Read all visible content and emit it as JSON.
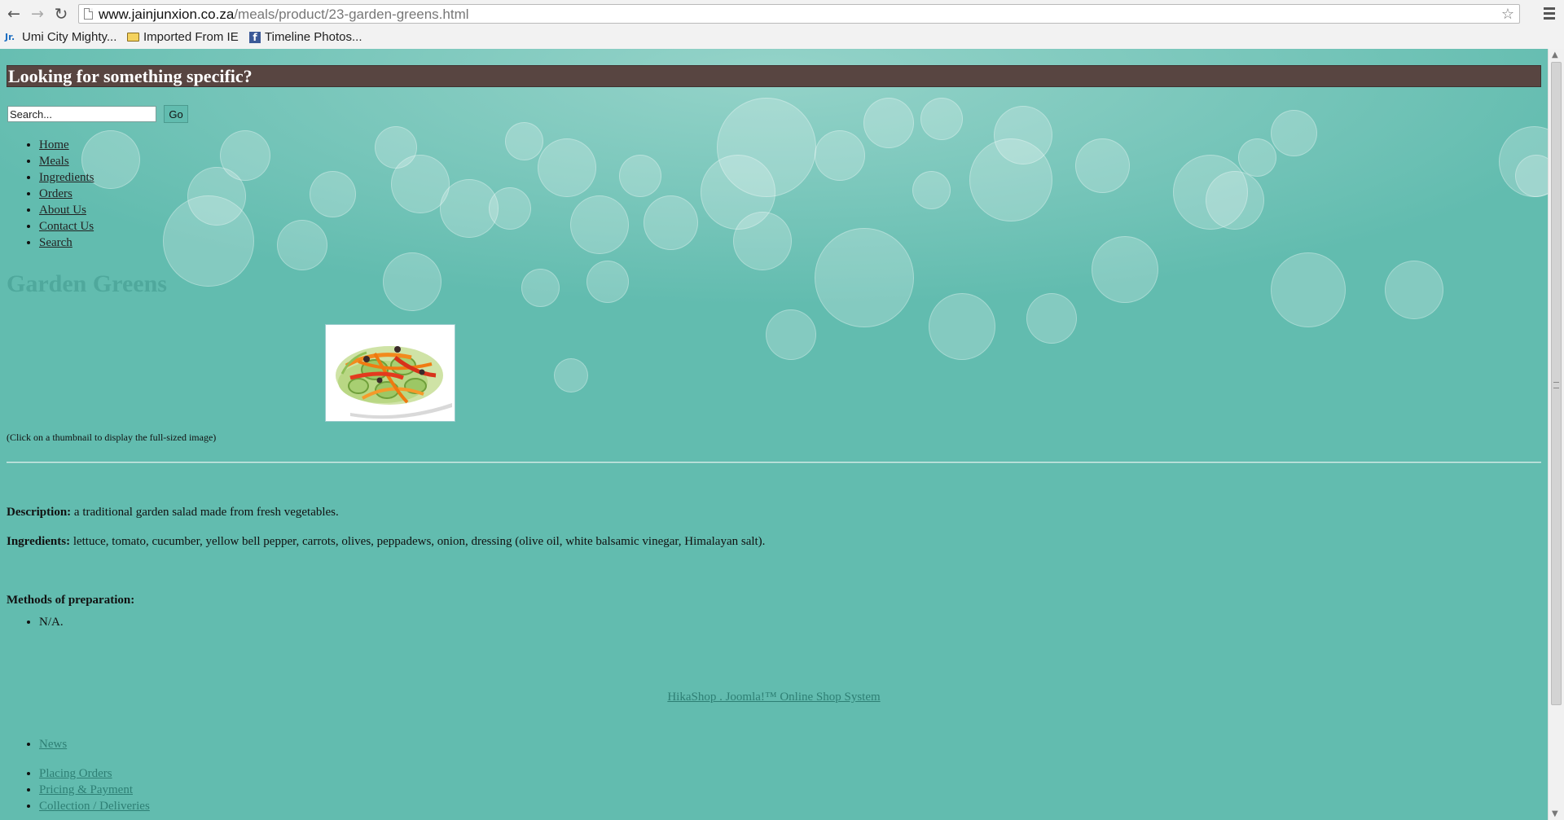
{
  "browser": {
    "url_host": "www.jainjunxion.co.za",
    "url_path": "/meals/product/23-garden-greens.html",
    "bookmarks": [
      {
        "label": "Umi City Mighty...",
        "icon": "jr-favicon-icon"
      },
      {
        "label": "Imported From IE",
        "icon": "folder-icon"
      },
      {
        "label": "Timeline Photos...",
        "icon": "facebook-icon"
      }
    ]
  },
  "page": {
    "search_banner": "Looking for something specific?",
    "search": {
      "placeholder": "Search...",
      "go_label": "Go"
    },
    "nav": [
      {
        "label": "Home"
      },
      {
        "label": "Meals"
      },
      {
        "label": "Ingredients"
      },
      {
        "label": "Orders"
      },
      {
        "label": "About Us"
      },
      {
        "label": "Contact Us"
      },
      {
        "label": "Search"
      }
    ],
    "product": {
      "title": "Garden Greens",
      "thumbnail_caption": "(Click on a thumbnail to display the full-sized image)",
      "description_label": "Description:",
      "description": " a traditional garden salad made from fresh vegetables.",
      "ingredients_label": "Ingredients:",
      "ingredients": " lettuce, tomato, cucumber, yellow bell pepper, carrots, olives, peppadews, onion, dressing (olive oil, white balsamic vinegar, Himalayan salt).",
      "methods_label": "Methods of preparation:",
      "methods": [
        "N/A."
      ]
    },
    "footer": {
      "credit_link": "HikaShop . Joomla!™ Online Shop System",
      "news": [
        "News"
      ],
      "info_links": [
        "Placing Orders",
        "Pricing & Payment",
        "Collection / Deliveries"
      ]
    }
  },
  "colors": {
    "page_background": "#62bcaf",
    "banner_background": "#584541",
    "title_color": "#4fa89c",
    "footer_link_color": "#2e7f74"
  }
}
